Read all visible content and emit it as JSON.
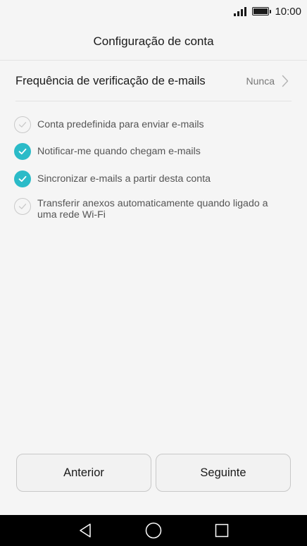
{
  "status_bar": {
    "time": "10:00",
    "icons": [
      "signal-icon",
      "battery-icon"
    ]
  },
  "header": {
    "title": "Configuração de conta"
  },
  "frequency": {
    "label": "Frequência de verificação de e-mails",
    "value": "Nunca"
  },
  "options": [
    {
      "label": "Conta predefinida para enviar e-mails",
      "checked": false
    },
    {
      "label": "Notificar-me quando chegam e-mails",
      "checked": true
    },
    {
      "label": "Sincronizar e-mails a partir desta conta",
      "checked": true
    },
    {
      "label": "Transferir anexos automaticamente quando ligado a uma rede Wi-Fi",
      "checked": false
    }
  ],
  "buttons": {
    "previous_label": "Anterior",
    "next_label": "Seguinte"
  },
  "navigation": {
    "icons": [
      "back-icon",
      "home-icon",
      "recents-icon"
    ]
  },
  "colors": {
    "accent": "#2bbbc8",
    "background": "#f5f5f5",
    "nav_bar": "#000000"
  }
}
